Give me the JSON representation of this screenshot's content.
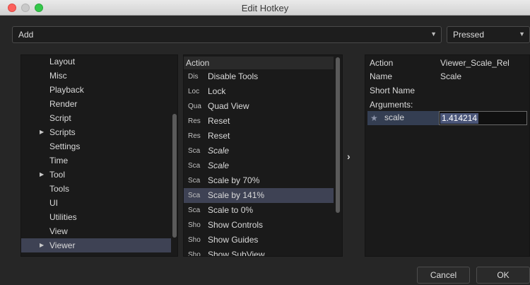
{
  "window": {
    "title": "Edit Hotkey"
  },
  "controls": {
    "mode_value": "Add",
    "trigger_value": "Pressed"
  },
  "categories": [
    {
      "label": "Layout",
      "expandable": false,
      "selected": false
    },
    {
      "label": "Misc",
      "expandable": false,
      "selected": false
    },
    {
      "label": "Playback",
      "expandable": false,
      "selected": false
    },
    {
      "label": "Render",
      "expandable": false,
      "selected": false
    },
    {
      "label": "Script",
      "expandable": false,
      "selected": false
    },
    {
      "label": "Scripts",
      "expandable": true,
      "selected": false
    },
    {
      "label": "Settings",
      "expandable": false,
      "selected": false
    },
    {
      "label": "Time",
      "expandable": false,
      "selected": false
    },
    {
      "label": "Tool",
      "expandable": true,
      "selected": false
    },
    {
      "label": "Tools",
      "expandable": false,
      "selected": false
    },
    {
      "label": "UI",
      "expandable": false,
      "selected": false
    },
    {
      "label": "Utilities",
      "expandable": false,
      "selected": false
    },
    {
      "label": "View",
      "expandable": false,
      "selected": false
    },
    {
      "label": "Viewer",
      "expandable": true,
      "selected": true
    }
  ],
  "actions": {
    "header": "Action",
    "items": [
      {
        "abbr": "Dis",
        "label": "Disable Tools",
        "italic": false,
        "selected": false
      },
      {
        "abbr": "Loc",
        "label": "Lock",
        "italic": false,
        "selected": false
      },
      {
        "abbr": "Qua",
        "label": "Quad View",
        "italic": false,
        "selected": false
      },
      {
        "abbr": "Res",
        "label": "Reset",
        "italic": false,
        "selected": false
      },
      {
        "abbr": "Res",
        "label": "Reset",
        "italic": false,
        "selected": false
      },
      {
        "abbr": "Sca",
        "label": "Scale",
        "italic": true,
        "selected": false
      },
      {
        "abbr": "Sca",
        "label": "Scale",
        "italic": true,
        "selected": false
      },
      {
        "abbr": "Sca",
        "label": "Scale by 70%",
        "italic": false,
        "selected": false
      },
      {
        "abbr": "Sca",
        "label": "Scale by 141%",
        "italic": false,
        "selected": true
      },
      {
        "abbr": "Sca",
        "label": "Scale to 0%",
        "italic": false,
        "selected": false
      },
      {
        "abbr": "Sho",
        "label": "Show Controls",
        "italic": false,
        "selected": false
      },
      {
        "abbr": "Sho",
        "label": "Show Guides",
        "italic": false,
        "selected": false
      },
      {
        "abbr": "Sho",
        "label": "Show SubView",
        "italic": false,
        "selected": false
      }
    ]
  },
  "move_arrow": "›",
  "properties": {
    "action_label": "Action",
    "action_value": "Viewer_Scale_Rel",
    "name_label": "Name",
    "name_value": "Scale",
    "short_name_label": "Short Name",
    "arguments_label": "Arguments:",
    "argument": {
      "icon": "star-icon",
      "glyph": "★",
      "name": "scale",
      "value": "1.414214"
    }
  },
  "buttons": {
    "cancel": "Cancel",
    "ok": "OK"
  }
}
